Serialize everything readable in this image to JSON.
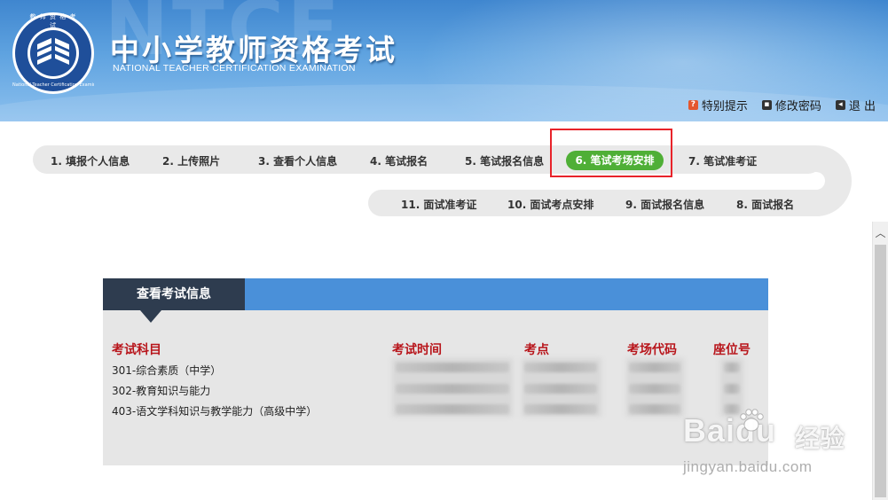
{
  "header": {
    "title": "中小学教师资格考试",
    "subtitle": "NATIONAL TEACHER CERTIFICATION EXAMINATION",
    "watermark": "NTCE",
    "logo": {
      "top_text": "教 师 资 格 考 试",
      "ring_text": "National Teacher Certification Examination",
      "icon": "book-stack-emblem"
    },
    "links": [
      {
        "label": "特别提示",
        "icon": "question-icon",
        "color": "#e4572e"
      },
      {
        "label": "修改密码",
        "icon": "key-icon",
        "color": "#333333"
      },
      {
        "label": "退 出",
        "icon": "exit-icon",
        "color": "#333333"
      }
    ]
  },
  "steps": {
    "row1": [
      "1. 填报个人信息",
      "2. 上传照片",
      "3. 查看个人信息",
      "4. 笔试报名",
      "5. 笔试报名信息",
      "6. 笔试考场安排",
      "7. 笔试准考证"
    ],
    "row2": [
      "11. 面试准考证",
      "10. 面试考点安排",
      "9. 面试报名信息",
      "8. 面试报名"
    ],
    "active_index": 5,
    "active_color": "#4faf36",
    "highlight_color": "#e8232a"
  },
  "panel": {
    "tab": "查看考试信息",
    "columns": [
      "考试科目",
      "考试时间",
      "考点",
      "考场代码",
      "座位号"
    ],
    "rows": [
      {
        "subject": "301-综合素质（中学）"
      },
      {
        "subject": "302-教育知识与能力"
      },
      {
        "subject": "403-语文学科知识与教学能力（高级中学）"
      }
    ],
    "header_color": "#b8151b",
    "bar_color": "#4a90d9",
    "tab_color": "#2e3c4f"
  },
  "watermark": {
    "brand": "Baidu",
    "brand_cn": "经验",
    "url": "jingyan.baidu.com"
  }
}
